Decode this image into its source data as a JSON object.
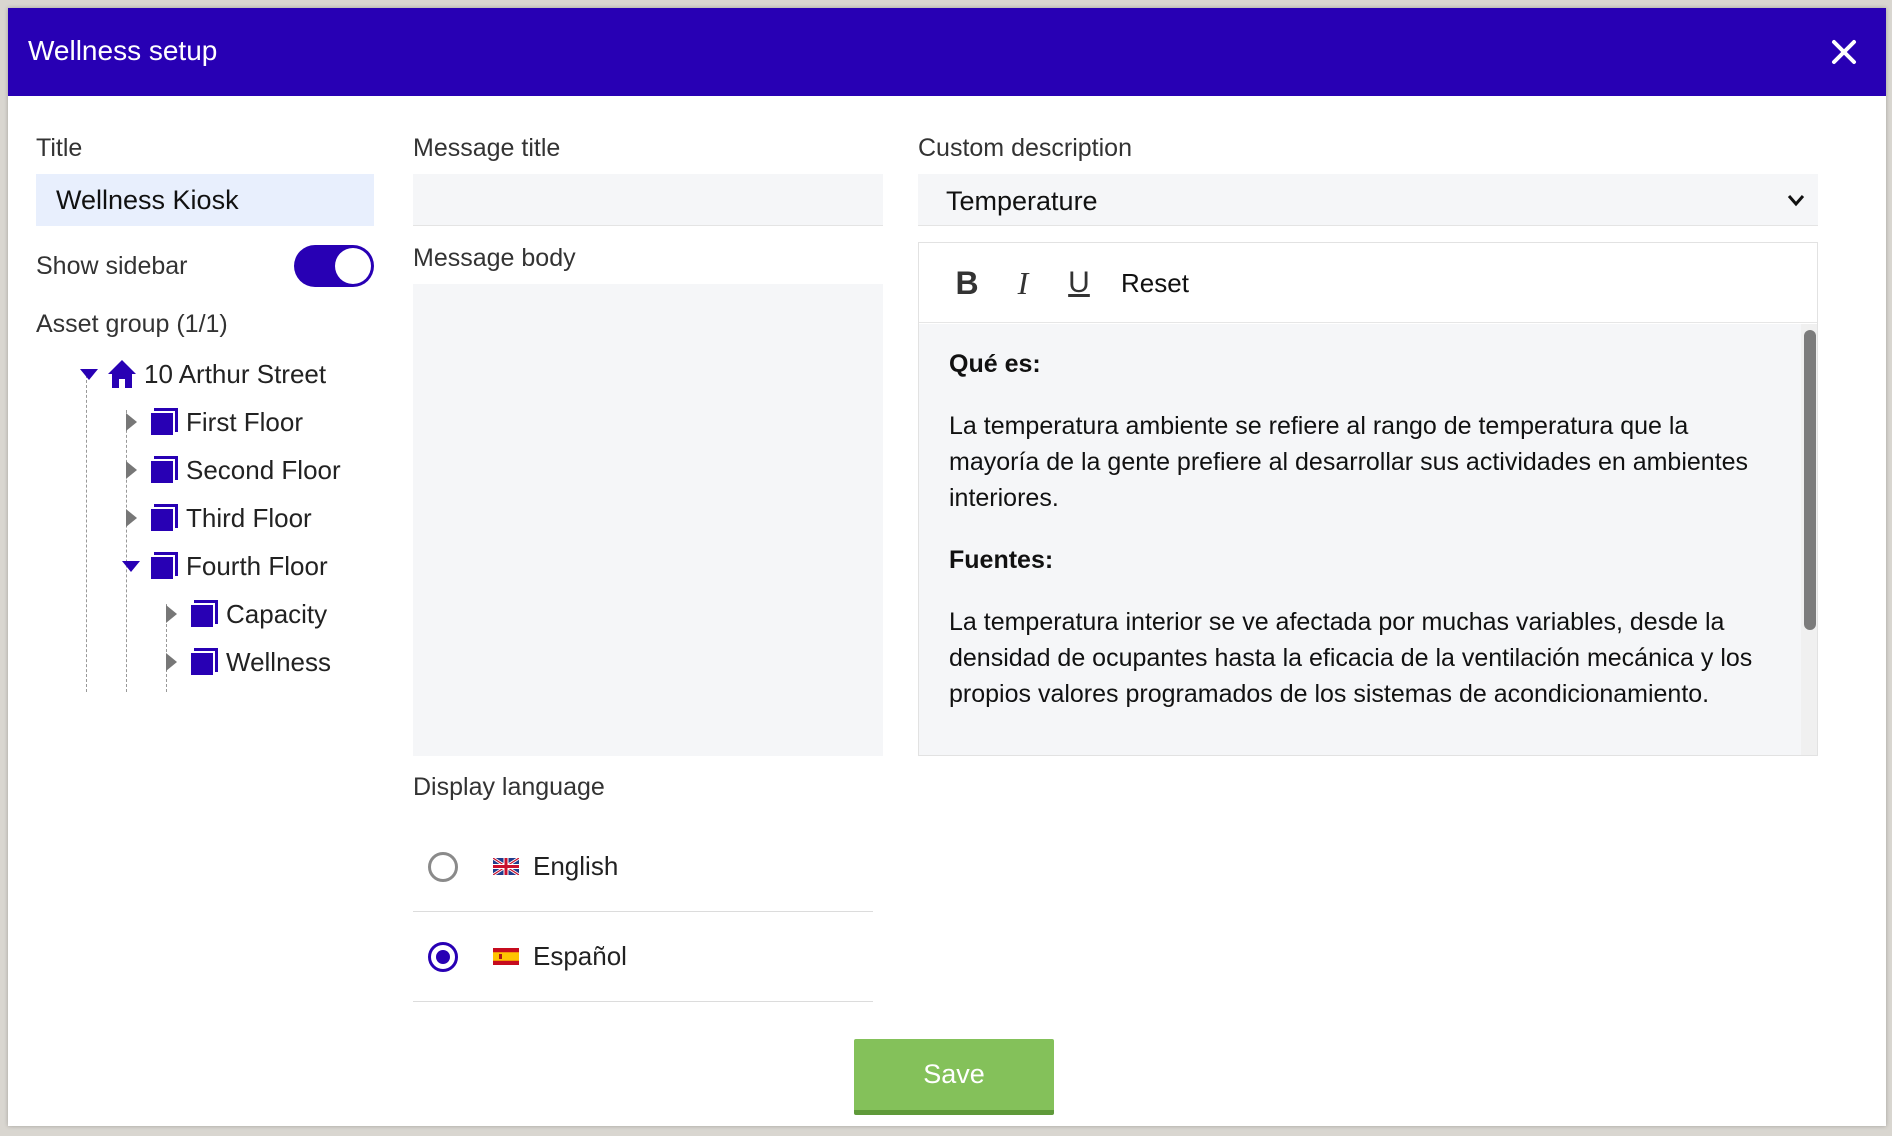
{
  "dialog": {
    "title": "Wellness setup",
    "header_color": "#2800b4",
    "close_icon": "close-icon"
  },
  "left": {
    "title_label": "Title",
    "title_value": "Wellness Kiosk",
    "show_sidebar_label": "Show sidebar",
    "show_sidebar_on": true,
    "asset_group_label": "Asset group (1/1)",
    "tree": {
      "root": {
        "label": "10 Arthur Street",
        "icon": "home-icon",
        "expanded": true
      },
      "children": [
        {
          "label": "First Floor",
          "icon": "floor-icon",
          "expanded": false
        },
        {
          "label": "Second Floor",
          "icon": "floor-icon",
          "expanded": false
        },
        {
          "label": "Third Floor",
          "icon": "floor-icon",
          "expanded": false
        },
        {
          "label": "Fourth Floor",
          "icon": "floor-icon",
          "expanded": true,
          "children": [
            {
              "label": "Capacity",
              "icon": "floor-icon",
              "expanded": false
            },
            {
              "label": "Wellness",
              "icon": "floor-icon",
              "expanded": false
            }
          ]
        }
      ]
    }
  },
  "middle": {
    "message_title_label": "Message title",
    "message_title_value": "",
    "message_body_label": "Message body",
    "message_body_value": "",
    "display_language_label": "Display language",
    "languages": [
      {
        "label": "English",
        "flag": "uk-flag-icon",
        "selected": false
      },
      {
        "label": "Español",
        "flag": "spain-flag-icon",
        "selected": true
      }
    ]
  },
  "right": {
    "custom_description_label": "Custom description",
    "description_select_value": "Temperature",
    "toolbar": {
      "bold": "B",
      "italic": "I",
      "underline": "U",
      "reset": "Reset"
    },
    "content": {
      "heading1": "Qué es:",
      "para1": "La temperatura ambiente se refiere al rango de temperatura que la mayoría de la gente prefiere al desarrollar sus actividades en ambientes interiores.",
      "heading2": "Fuentes:",
      "para2": "La temperatura interior se ve afectada por muchas variables, desde la densidad de ocupantes hasta la eficacia de la ventilación mecánica y los propios valores programados de los sistemas de acondicionamiento."
    }
  },
  "footer": {
    "save_label": "Save",
    "save_color": "#84c15a"
  }
}
